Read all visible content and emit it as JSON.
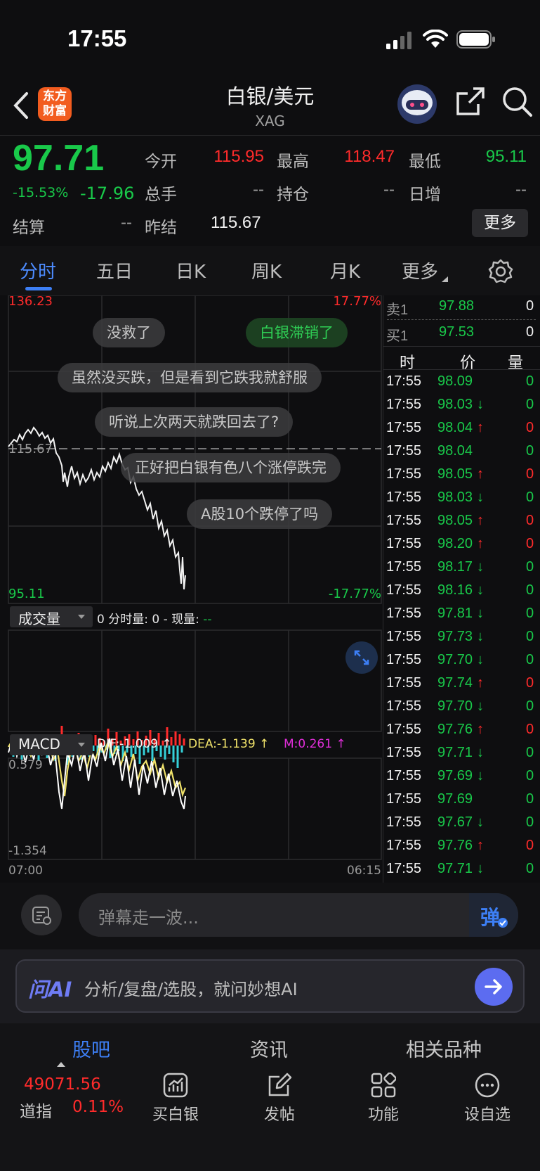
{
  "status": {
    "time": "17:55"
  },
  "nav": {
    "logo_line1": "东方",
    "logo_line2": "财富",
    "title": "白银/美元",
    "code": "XAG"
  },
  "quote": {
    "price": "97.71",
    "change_pct": "-15.53%",
    "change": "-17.96",
    "open_label": "今开",
    "open": "115.95",
    "high_label": "最高",
    "high": "118.47",
    "low_label": "最低",
    "low": "95.11",
    "volume_label": "总手",
    "volume": "--",
    "position_label": "持仓",
    "position": "--",
    "daily_add_label": "日增",
    "daily_add": "--",
    "settle_label": "结算",
    "settle": "--",
    "prev_settle_label": "昨结",
    "prev_settle": "115.67",
    "more_label": "更多"
  },
  "tabs": [
    "分时",
    "五日",
    "日K",
    "周K",
    "月K",
    "更多"
  ],
  "chart": {
    "y_max": "136.23",
    "y_min": "95.11",
    "pct_max": "17.77%",
    "pct_min": "-17.77%",
    "ref_label": "115.67",
    "volume_selector": "成交量",
    "volume_info_prefix": "0 分时量: 0 - 现量: ",
    "volume_info_now": "--",
    "macd_selector": "MACD",
    "dif": "DIF:-1.009 ↑",
    "dea": "DEA:-1.139 ↑",
    "m": "M:0.261 ↑",
    "macd_max": "0.579",
    "macd_min": "-1.354",
    "time_start": "07:00",
    "time_end": "06:15"
  },
  "danmu": [
    "没救了",
    "白银滞销了",
    "虽然没买跌，但是看到它跌我就舒服",
    "听说上次两天就跌回去了?",
    "正好把白银有色八个涨停跌完",
    "A股10个跌停了吗"
  ],
  "orderbook": {
    "sell_label": "卖1",
    "sell_price": "97.88",
    "sell_qty": "0",
    "buy_label": "买1",
    "buy_price": "97.53",
    "buy_qty": "0",
    "col_time": "时",
    "col_price": "价",
    "col_qty": "量"
  },
  "trades": [
    {
      "t": "17:55",
      "p": "98.09",
      "d": "",
      "q": "0",
      "c": "green"
    },
    {
      "t": "17:55",
      "p": "98.03",
      "d": "↓",
      "q": "0",
      "c": "green"
    },
    {
      "t": "17:55",
      "p": "98.04",
      "d": "↑",
      "q": "0",
      "c": "red"
    },
    {
      "t": "17:55",
      "p": "98.04",
      "d": "",
      "q": "0",
      "c": "green"
    },
    {
      "t": "17:55",
      "p": "98.05",
      "d": "↑",
      "q": "0",
      "c": "red"
    },
    {
      "t": "17:55",
      "p": "98.03",
      "d": "↓",
      "q": "0",
      "c": "green"
    },
    {
      "t": "17:55",
      "p": "98.05",
      "d": "↑",
      "q": "0",
      "c": "red"
    },
    {
      "t": "17:55",
      "p": "98.20",
      "d": "↑",
      "q": "0",
      "c": "red"
    },
    {
      "t": "17:55",
      "p": "98.17",
      "d": "↓",
      "q": "0",
      "c": "green"
    },
    {
      "t": "17:55",
      "p": "98.16",
      "d": "↓",
      "q": "0",
      "c": "green"
    },
    {
      "t": "17:55",
      "p": "97.81",
      "d": "↓",
      "q": "0",
      "c": "green"
    },
    {
      "t": "17:55",
      "p": "97.73",
      "d": "↓",
      "q": "0",
      "c": "green"
    },
    {
      "t": "17:55",
      "p": "97.70",
      "d": "↓",
      "q": "0",
      "c": "green"
    },
    {
      "t": "17:55",
      "p": "97.74",
      "d": "↑",
      "q": "0",
      "c": "red"
    },
    {
      "t": "17:55",
      "p": "97.70",
      "d": "↓",
      "q": "0",
      "c": "green"
    },
    {
      "t": "17:55",
      "p": "97.76",
      "d": "↑",
      "q": "0",
      "c": "red"
    },
    {
      "t": "17:55",
      "p": "97.71",
      "d": "↓",
      "q": "0",
      "c": "green"
    },
    {
      "t": "17:55",
      "p": "97.69",
      "d": "↓",
      "q": "0",
      "c": "green"
    },
    {
      "t": "17:55",
      "p": "97.69",
      "d": "",
      "q": "0",
      "c": "green"
    },
    {
      "t": "17:55",
      "p": "97.67",
      "d": "↓",
      "q": "0",
      "c": "green"
    },
    {
      "t": "17:55",
      "p": "97.76",
      "d": "↑",
      "q": "0",
      "c": "red"
    },
    {
      "t": "17:55",
      "p": "97.71",
      "d": "↓",
      "q": "0",
      "c": "green"
    }
  ],
  "input": {
    "placeholder": "弹幕走一波...",
    "send_label": "弹"
  },
  "ai": {
    "logo": "问AI",
    "placeholder": "分析/复盘/选股，就问妙想AI"
  },
  "bottom_tabs": [
    "股吧",
    "资讯",
    "相关品种"
  ],
  "footer": {
    "index_value": "49071.56",
    "index_name": "道指",
    "index_change": "0.11%",
    "items": [
      "买白银",
      "发帖",
      "功能",
      "设自选"
    ]
  },
  "colors": {
    "up": "#ff2b2b",
    "down": "#19c94a",
    "accent": "#3d7ff5"
  }
}
